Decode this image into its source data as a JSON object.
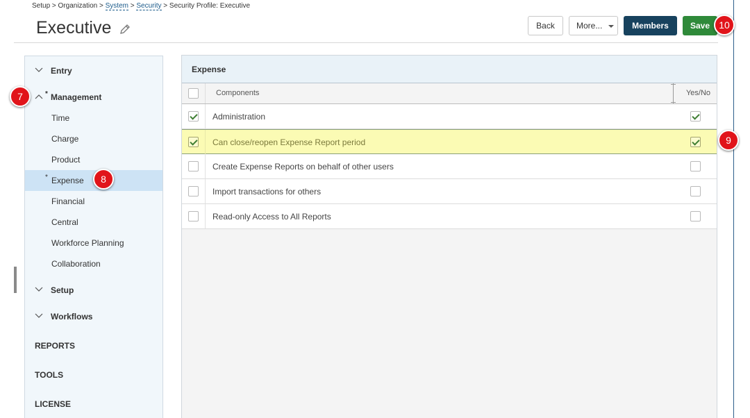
{
  "breadcrumb": {
    "part1": "Setup > Organization >",
    "system": "System",
    "sep2": ">",
    "security": "Security",
    "sep3": "> Security Profile: Executive"
  },
  "page_title": "Executive",
  "toolbar": {
    "back_label": "Back",
    "more_label": "More...",
    "members_label": "Members",
    "save_label": "Save"
  },
  "markers": {
    "m7": "7",
    "m8": "8",
    "m9": "9",
    "m10": "10"
  },
  "sidebar": {
    "entry": "Entry",
    "management": "Management",
    "star": "*",
    "items": [
      "Time",
      "Charge",
      "Product",
      "Expense",
      "Financial",
      "Central",
      "Workforce Planning",
      "Collaboration"
    ],
    "setup": "Setup",
    "workflows": "Workflows",
    "reports": "REPORTS",
    "tools": "TOOLS",
    "license": "LICENSE"
  },
  "panel": {
    "title": "Expense",
    "col_components": "Components",
    "col_yesno": "Yes/No",
    "rows": [
      {
        "label": "Administration",
        "selected": true,
        "value": true
      },
      {
        "label": "Can close/reopen Expense Report period",
        "selected": true,
        "value": true
      },
      {
        "label": "Create Expense Reports on behalf of other users",
        "selected": false,
        "value": false
      },
      {
        "label": "Import transactions for others",
        "selected": false,
        "value": false
      },
      {
        "label": "Read-only Access to All Reports",
        "selected": false,
        "value": false
      }
    ]
  },
  "colors": {
    "members_button": "#17425e",
    "save_button": "#2f8a3a",
    "marker": "#e1141a",
    "highlight_row": "#fbfbb4",
    "sidebar_active": "#cde3f5"
  }
}
